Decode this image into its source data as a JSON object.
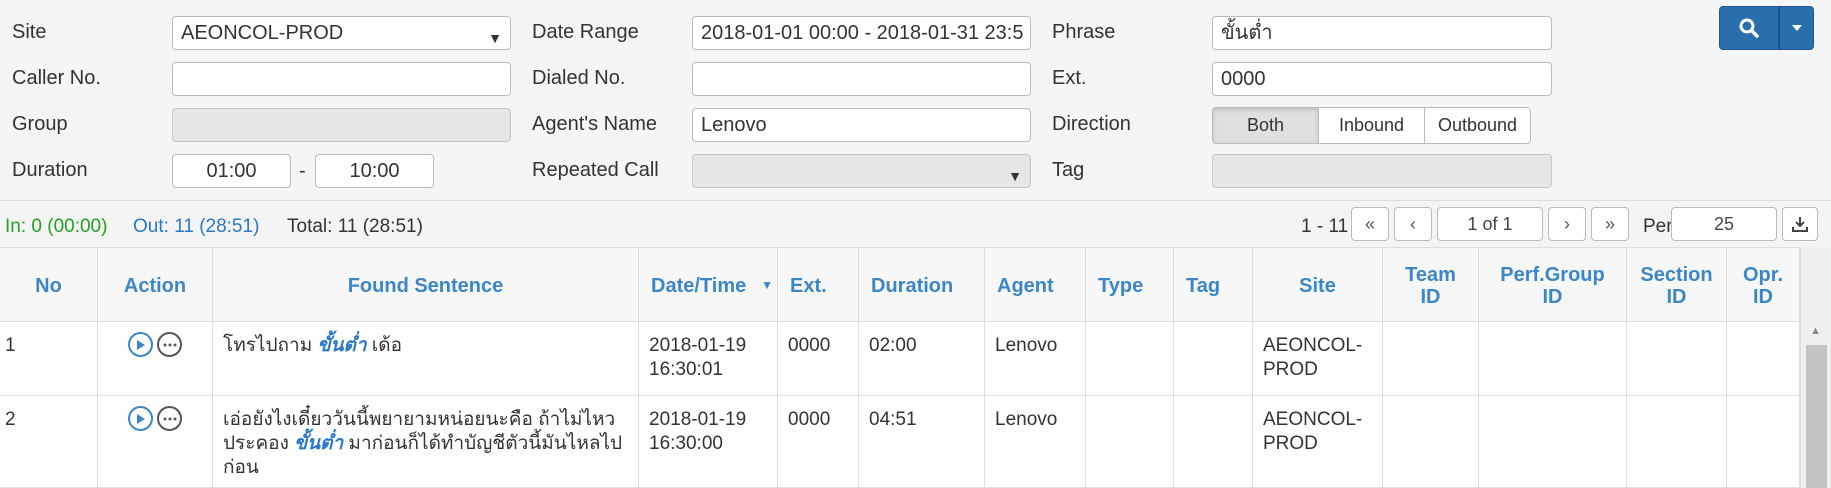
{
  "filters": {
    "site": {
      "label": "Site",
      "value": "AEONCOL-PROD"
    },
    "date_range": {
      "label": "Date Range",
      "value": "2018-01-01 00:00 - 2018-01-31 23:5"
    },
    "phrase": {
      "label": "Phrase",
      "value": "ขั้นต่ำ"
    },
    "caller_no": {
      "label": "Caller No.",
      "value": ""
    },
    "dialed_no": {
      "label": "Dialed No.",
      "value": ""
    },
    "ext": {
      "label": "Ext.",
      "value": "0000"
    },
    "group": {
      "label": "Group",
      "value": ""
    },
    "agent_name": {
      "label": "Agent's Name",
      "value": "Lenovo"
    },
    "direction": {
      "label": "Direction",
      "options": [
        "Both",
        "Inbound",
        "Outbound"
      ],
      "selected": "Both"
    },
    "duration": {
      "label": "Duration",
      "from": "01:00",
      "separator": "-",
      "to": "10:00"
    },
    "repeated_call": {
      "label": "Repeated Call",
      "value": ""
    },
    "tag": {
      "label": "Tag",
      "value": ""
    }
  },
  "status": {
    "in_label": "In:",
    "in_value": "0 (00:00)",
    "out_label": "Out:",
    "out_value": "11 (28:51)",
    "total_label": "Total:",
    "total_value": "11 (28:51)",
    "in_color": "#22a022",
    "out_color": "#2a78c6"
  },
  "pager": {
    "range": "1 - 11",
    "first": "«",
    "prev": "‹",
    "page_display": "1 of 1",
    "next": "›",
    "last": "»",
    "per_label": "Per",
    "per_value": "25"
  },
  "table": {
    "columns": [
      "No",
      "Action",
      "Found Sentence",
      "Date/Time",
      "Ext.",
      "Duration",
      "Agent",
      "Type",
      "Tag",
      "Site",
      "Team ID",
      "Perf.Group ID",
      "Section ID",
      "Opr. ID"
    ],
    "rows": [
      {
        "no": "1",
        "sentence_pre": "โทรไปถาม ",
        "sentence_hl": "ขั้นต่ำ",
        "sentence_post": " เด้อ",
        "datetime": "2018-01-19 16:30:01",
        "ext": "0000",
        "duration": "02:00",
        "agent": "Lenovo",
        "type": "",
        "tag": "",
        "site": "AEONCOL-PROD",
        "team_id": "",
        "perf_group_id": "",
        "section_id": "",
        "opr_id": ""
      },
      {
        "no": "2",
        "sentence_pre": "เอ่อยังไงเดี๋ยววันนี้พยายามหน่อยนะคือ ถ้าไม่ไหวประคอง ",
        "sentence_hl": "ขั้นต่ำ",
        "sentence_post": " มาก่อนก็ได้ทำบัญชีตัวนี้มันไหลไปก่อน",
        "datetime": "2018-01-19 16:30:00",
        "ext": "0000",
        "duration": "04:51",
        "agent": "Lenovo",
        "type": "",
        "tag": "",
        "site": "AEONCOL-PROD",
        "team_id": "",
        "perf_group_id": "",
        "section_id": "",
        "opr_id": ""
      }
    ]
  },
  "colors": {
    "accent": "#3b86c6",
    "primary_button": "#2a6fad"
  },
  "icons": {
    "search": "search-icon",
    "dropdown": "caret-down-icon",
    "download": "download-icon",
    "play": "play-icon",
    "more": "more-icon",
    "sort": "sort-down-icon"
  }
}
